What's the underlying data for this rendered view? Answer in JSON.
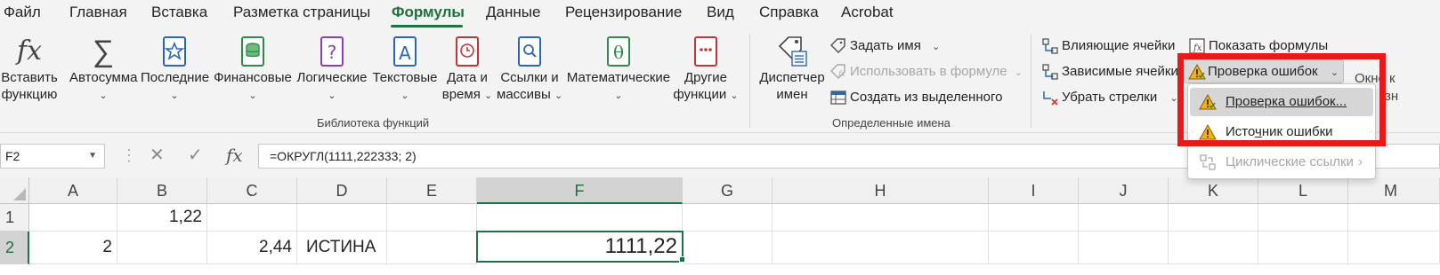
{
  "menu": {
    "tabs": [
      "Файл",
      "Главная",
      "Вставка",
      "Разметка страницы",
      "Формулы",
      "Данные",
      "Рецензирование",
      "Вид",
      "Справка",
      "Acrobat"
    ],
    "active": "Формулы"
  },
  "ribbon": {
    "library": {
      "insert_fn": [
        "Вставить",
        "функцию"
      ],
      "autosum": "Автосумма",
      "recent": "Последние",
      "financial": "Финансовые",
      "logical": "Логические",
      "text": "Текстовые",
      "datetime": [
        "Дата и",
        "время"
      ],
      "lookup": [
        "Ссылки и",
        "массивы"
      ],
      "math": "Математические",
      "more": [
        "Другие",
        "функции"
      ],
      "group_label": "Библиотека функций"
    },
    "names": {
      "manager": [
        "Диспетчер",
        "имен"
      ],
      "define": "Задать имя",
      "use_in_formula": "Использовать в формуле",
      "create_from_sel": "Создать из выделенного",
      "group_label": "Определенные имена"
    },
    "audit": {
      "precedents": "Влияющие ячейки",
      "dependents": "Зависимые ячейки",
      "remove_arrows": "Убрать стрелки",
      "show_formulas": "Показать формулы",
      "error_check": "Проверка ошибок"
    },
    "window_partial": [
      "Окно к",
      "зн"
    ]
  },
  "dropdown": {
    "items": [
      {
        "label": "Проверка ошибок...",
        "icon": "error-check-icon",
        "highlighted": true,
        "disabled": false
      },
      {
        "label_pre": "Исто",
        "label_u": "ч",
        "label_post": "ник ошибки",
        "icon": "trace-error-icon",
        "highlighted": false,
        "disabled": false
      },
      {
        "label": "Циклические ссылки",
        "icon": "circular-ref-icon",
        "highlighted": false,
        "disabled": true
      }
    ]
  },
  "formula_bar": {
    "name_box": "F2",
    "fx": "fx",
    "formula": "=ОКРУГЛ(1111,222333; 2)"
  },
  "sheet": {
    "columns": [
      "A",
      "B",
      "C",
      "D",
      "E",
      "F",
      "G",
      "H",
      "I",
      "J",
      "K",
      "L",
      "M"
    ],
    "rows": [
      "1",
      "2"
    ],
    "selected_cell": "F2",
    "cells": {
      "B1": "1,22",
      "A2": "2",
      "C2": "2,44",
      "D2": "ИСТИНА",
      "F2": "1111,22"
    }
  },
  "colors": {
    "accent": "#1f7244",
    "highlight_frame": "#e81919"
  }
}
